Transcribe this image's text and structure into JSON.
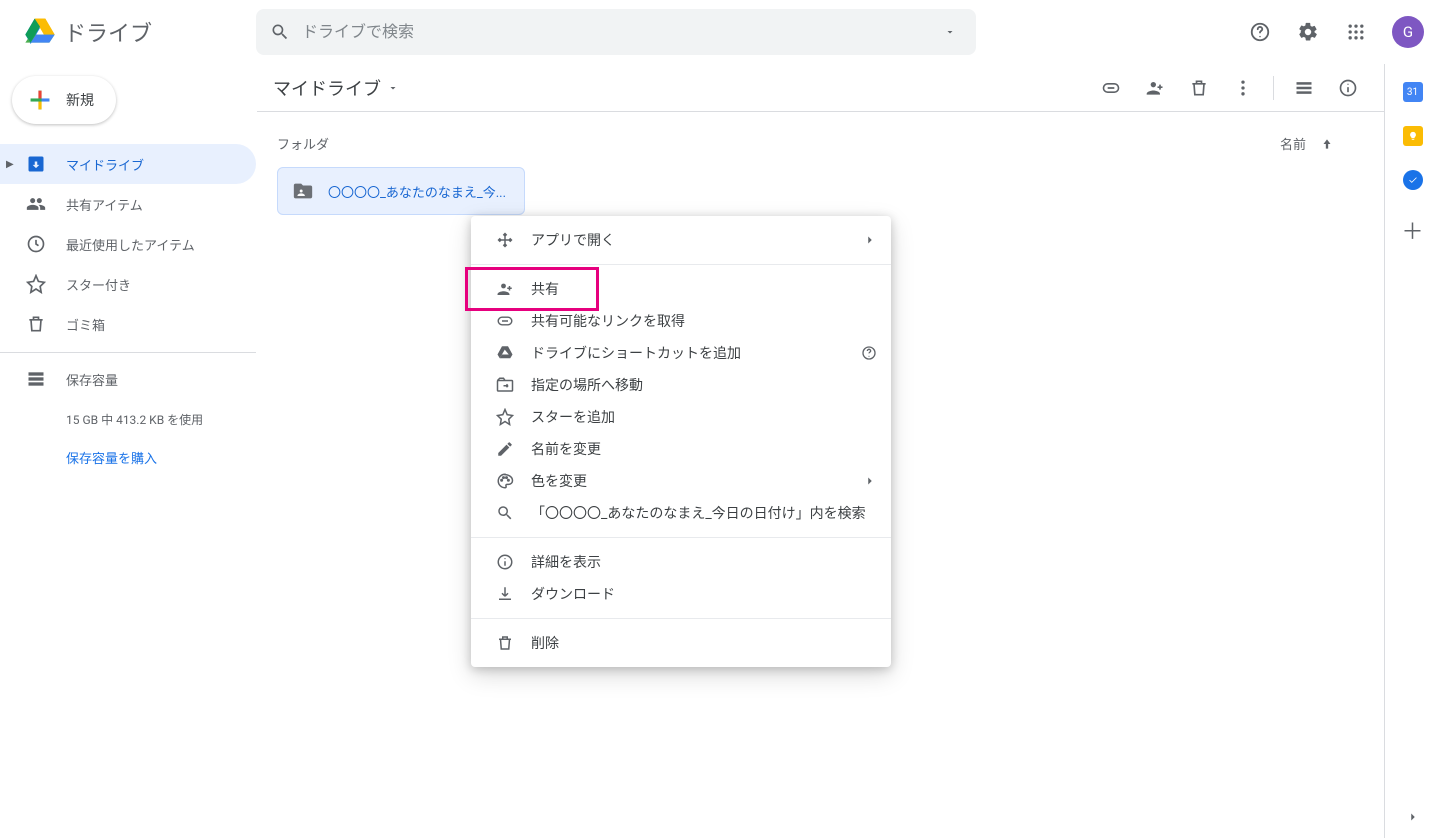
{
  "header": {
    "app_name": "ドライブ",
    "search_placeholder": "ドライブで検索",
    "avatar_letter": "G"
  },
  "sidebar": {
    "new_label": "新規",
    "items": [
      {
        "label": "マイドライブ"
      },
      {
        "label": "共有アイテム"
      },
      {
        "label": "最近使用したアイテム"
      },
      {
        "label": "スター付き"
      },
      {
        "label": "ゴミ箱"
      }
    ],
    "storage_label": "保存容量",
    "storage_usage": "15 GB 中 413.2 KB を使用",
    "storage_buy": "保存容量を購入"
  },
  "main": {
    "breadcrumb": "マイドライブ",
    "section_folders": "フォルダ",
    "sort_label": "名前",
    "folder_name": "〇〇〇〇_あなたのなまえ_今..."
  },
  "context_menu": {
    "open_with": "アプリで開く",
    "share": "共有",
    "get_link": "共有可能なリンクを取得",
    "add_shortcut": "ドライブにショートカットを追加",
    "move_to": "指定の場所へ移動",
    "add_star": "スターを追加",
    "rename": "名前を変更",
    "change_color": "色を変更",
    "search_within": "「〇〇〇〇_あなたのなまえ_今日の日付け」内を検索",
    "view_details": "詳細を表示",
    "download": "ダウンロード",
    "remove": "削除"
  },
  "side_panel": {
    "cal": "31"
  }
}
